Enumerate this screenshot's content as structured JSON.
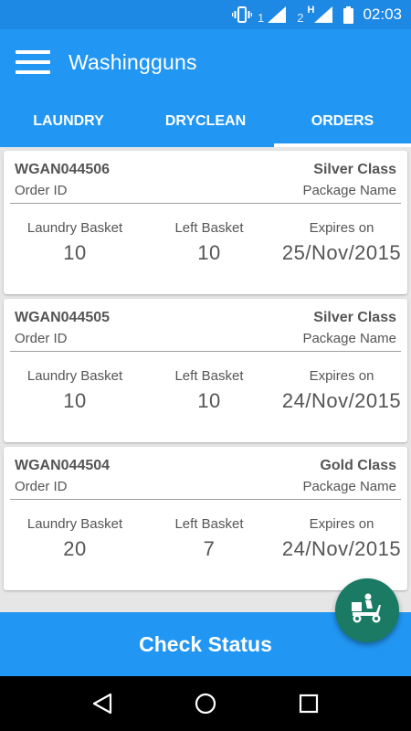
{
  "status_bar": {
    "sim1": "1",
    "sim2": "2",
    "network_type": "H",
    "time": "02:03",
    "icons": [
      "vibrate-icon",
      "signal-icon",
      "signal-icon",
      "battery-icon"
    ]
  },
  "app_bar": {
    "title": "Washingguns",
    "menu_icon": "hamburger-menu-icon"
  },
  "tabs": [
    {
      "label": "LAUNDRY",
      "active": false
    },
    {
      "label": "DRYCLEAN",
      "active": false
    },
    {
      "label": "ORDERS",
      "active": true
    }
  ],
  "labels": {
    "order_id": "Order ID",
    "package_name": "Package Name",
    "laundry_basket": "Laundry Basket",
    "left_basket": "Left Basket",
    "expires_on": "Expires on"
  },
  "orders": [
    {
      "order_id": "WGAN044506",
      "package": "Silver Class",
      "laundry_basket": "10",
      "left_basket": "10",
      "expires": "25/Nov/2015"
    },
    {
      "order_id": "WGAN044505",
      "package": "Silver Class",
      "laundry_basket": "10",
      "left_basket": "10",
      "expires": "24/Nov/2015"
    },
    {
      "order_id": "WGAN044504",
      "package": "Gold Class",
      "laundry_basket": "20",
      "left_basket": "7",
      "expires": "24/Nov/2015"
    }
  ],
  "check_status_label": "Check Status",
  "fab_icon": "delivery-scooter-icon",
  "colors": {
    "primary": "#2196f3",
    "status_bar": "#1e88e5",
    "fab": "#1a7a64",
    "background": "#e6e6e6",
    "text": "#555555"
  },
  "nav_icons": [
    "back-icon",
    "home-icon",
    "recents-icon"
  ]
}
